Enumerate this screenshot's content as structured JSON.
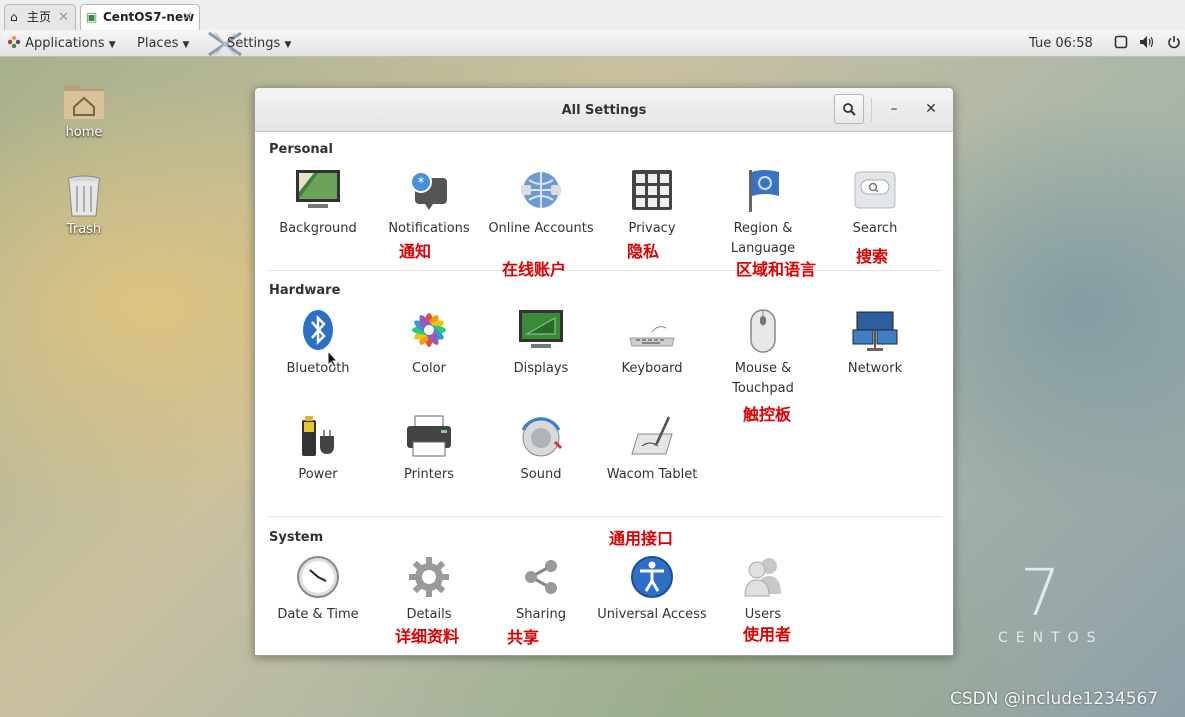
{
  "browser_tabs": [
    {
      "label": "主页",
      "icon": "home-icon",
      "active": false
    },
    {
      "label": "CentOS7-new",
      "icon": "vm-icon",
      "active": true
    }
  ],
  "top_bar": {
    "applications": "Applications",
    "places": "Places",
    "settings": "Settings",
    "clock": "Tue 06:58"
  },
  "desktop_icons": [
    {
      "label": "home",
      "icon": "home-folder-icon"
    },
    {
      "label": "Trash",
      "icon": "trash-icon"
    }
  ],
  "window": {
    "title": "All Settings",
    "sections": [
      {
        "title": "Personal",
        "items": [
          {
            "label": "Background",
            "icon": "background-icon"
          },
          {
            "label": "Notifications",
            "icon": "notifications-icon"
          },
          {
            "label": "Online Accounts",
            "icon": "online-accounts-icon"
          },
          {
            "label": "Privacy",
            "icon": "privacy-icon"
          },
          {
            "label": "Region & Language",
            "icon": "region-language-icon"
          },
          {
            "label": "Search",
            "icon": "search-settings-icon"
          }
        ]
      },
      {
        "title": "Hardware",
        "items": [
          {
            "label": "Bluetooth",
            "icon": "bluetooth-icon"
          },
          {
            "label": "Color",
            "icon": "color-icon"
          },
          {
            "label": "Displays",
            "icon": "displays-icon"
          },
          {
            "label": "Keyboard",
            "icon": "keyboard-icon"
          },
          {
            "label": "Mouse & Touchpad",
            "icon": "mouse-icon"
          },
          {
            "label": "Network",
            "icon": "network-icon"
          },
          {
            "label": "Power",
            "icon": "power-battery-icon"
          },
          {
            "label": "Printers",
            "icon": "printer-icon"
          },
          {
            "label": "Sound",
            "icon": "sound-icon"
          },
          {
            "label": "Wacom Tablet",
            "icon": "wacom-tablet-icon"
          }
        ]
      },
      {
        "title": "System",
        "items": [
          {
            "label": "Date & Time",
            "icon": "clock-icon"
          },
          {
            "label": "Details",
            "icon": "gear-icon"
          },
          {
            "label": "Sharing",
            "icon": "share-icon"
          },
          {
            "label": "Universal Access",
            "icon": "accessibility-icon"
          },
          {
            "label": "Users",
            "icon": "users-icon"
          }
        ]
      }
    ]
  },
  "annotations": {
    "notifications": "通知",
    "online_accounts": "在线账户",
    "privacy": "隐私",
    "region_language": "区域和语言",
    "search": "搜索",
    "mouse_touchpad": "触控板",
    "universal_access": "通用接口",
    "details": "详细资料",
    "sharing": "共享",
    "users": "使用者"
  },
  "branding": {
    "version": "7",
    "name": "CENTOS"
  },
  "watermark": "CSDN @include1234567",
  "colors": {
    "annotation": "#e00000",
    "accent": "#4a90d9"
  }
}
